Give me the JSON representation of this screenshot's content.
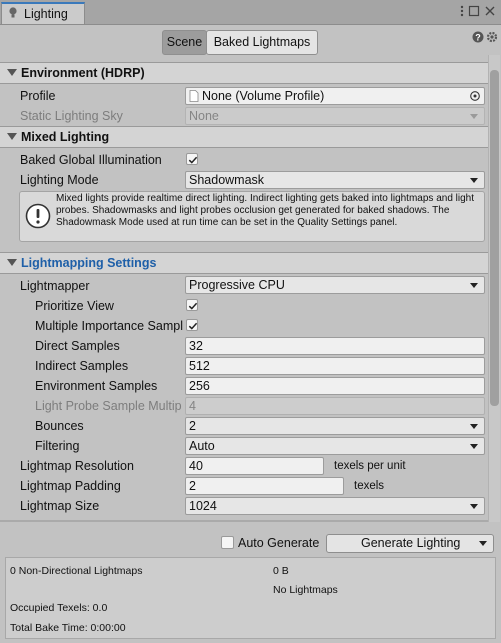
{
  "window": {
    "tab_label": "Lighting"
  },
  "toggles": {
    "scene": "Scene",
    "baked": "Baked Lightmaps"
  },
  "environment": {
    "title": "Environment (HDRP)",
    "profile_label": "Profile",
    "profile_value": "None (Volume Profile)",
    "static_sky_label": "Static Lighting Sky",
    "static_sky_value": "None"
  },
  "mixed": {
    "title": "Mixed Lighting",
    "baked_gi_label": "Baked Global Illumination",
    "baked_gi_checked": true,
    "mode_label": "Lighting Mode",
    "mode_value": "Shadowmask",
    "help_text": "Mixed lights provide realtime direct lighting. Indirect lighting gets baked into lightmaps and light probes. Shadowmasks and light probes occlusion get generated for baked shadows. The Shadowmask Mode used at run time can be set in the Quality Settings panel."
  },
  "lightmapping": {
    "title": "Lightmapping Settings",
    "lightmapper_label": "Lightmapper",
    "lightmapper_value": "Progressive CPU",
    "prioritize_label": "Prioritize View",
    "prioritize_checked": true,
    "mis_label": "Multiple Importance Sampl",
    "mis_checked": true,
    "direct_label": "Direct Samples",
    "direct_value": "32",
    "indirect_label": "Indirect Samples",
    "indirect_value": "512",
    "env_label": "Environment Samples",
    "env_value": "256",
    "probe_mult_label": "Light Probe Sample Multip",
    "probe_mult_value": "4",
    "bounces_label": "Bounces",
    "bounces_value": "2",
    "filtering_label": "Filtering",
    "filtering_value": "Auto",
    "resolution_label": "Lightmap Resolution",
    "resolution_value": "40",
    "resolution_unit": "texels per unit",
    "padding_label": "Lightmap Padding",
    "padding_value": "2",
    "padding_unit": "texels",
    "size_label": "Lightmap Size",
    "size_value": "1024"
  },
  "bottom": {
    "auto_generate_label": "Auto Generate",
    "auto_generate_checked": false,
    "generate_button": "Generate Lighting"
  },
  "stats": {
    "lightmaps": "0 Non-Directional Lightmaps",
    "size": "0 B",
    "no_lightmaps": "No Lightmaps",
    "occupied": "Occupied Texels: 0.0",
    "bake_time": "Total Bake Time: 0:00:00"
  },
  "colors": {
    "accent_tab": "#3a79bb",
    "section_blue": "#1e5fa8"
  }
}
